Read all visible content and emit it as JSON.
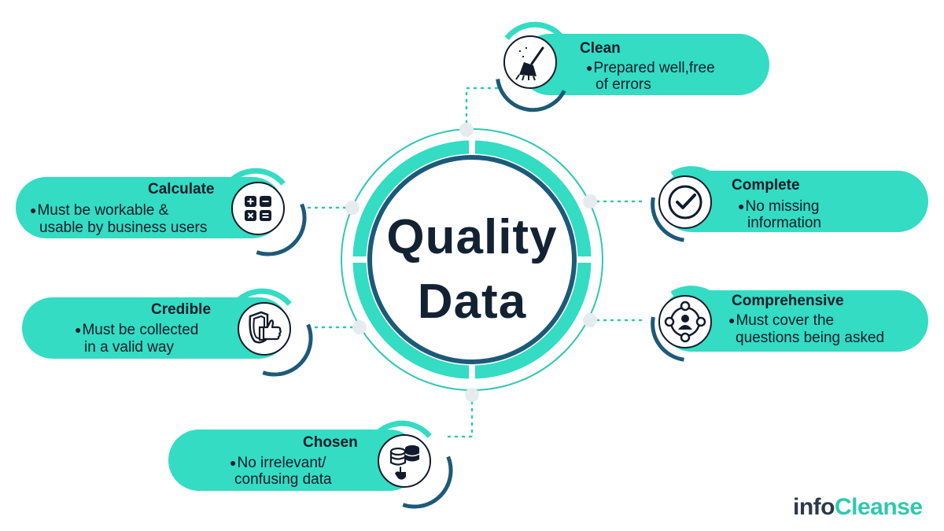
{
  "center": {
    "line1": "Quality",
    "line2": "Data"
  },
  "items": {
    "clean": {
      "title": "Clean",
      "line1": "Prepared well,free",
      "line2": "of errors",
      "icon": "broom-icon"
    },
    "complete": {
      "title": "Complete",
      "line1": "No missing",
      "line2": "information",
      "icon": "checkmark-icon"
    },
    "comprehensive": {
      "title": "Comprehensive",
      "line1": "Must cover the",
      "line2": "questions being asked",
      "icon": "network-person-icon"
    },
    "calculate": {
      "title": "Calculate",
      "line1": "Must be workable &",
      "line2": "usable by business users",
      "icon": "calculator-icon"
    },
    "credible": {
      "title": "Credible",
      "line1": "Must be collected",
      "line2": "in a valid way",
      "icon": "shield-thumbs-up-icon"
    },
    "chosen": {
      "title": "Chosen",
      "line1": "No irrelevant/",
      "line2": "confusing data",
      "icon": "database-select-icon"
    }
  },
  "logo": {
    "part1": "info",
    "part2": "Cleanse"
  },
  "colors": {
    "pill": "#33dcc3",
    "accent": "#1ec2b0",
    "dark_ring": "#1d5a78",
    "text": "#111b2b"
  }
}
